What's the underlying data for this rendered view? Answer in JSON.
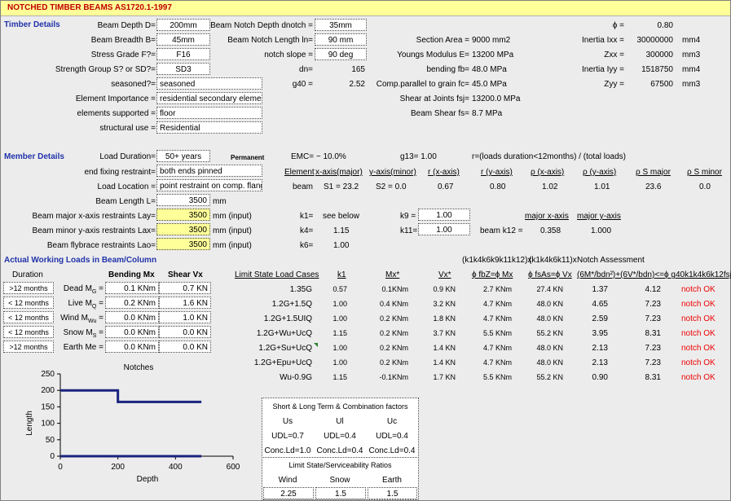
{
  "title": "NOTCHED TIMBER BEAMS  AS1720.1-1997",
  "timber": {
    "section_label": "Timber Details",
    "depth_label": "Beam Depth D=",
    "depth_value": "200mm",
    "breadth_label": "Beam Breadth B=",
    "breadth_value": "45mm",
    "grade_label": "Stress Grade F?=",
    "grade_value": "F16",
    "group_label": "Strength Group S? or SD?=",
    "group_value": "SD3",
    "seasoned_label": "seasoned?=",
    "seasoned_value": "seasoned",
    "importance_label": "Element Importance =",
    "importance_value": "residential secondary element",
    "supported_label": "elements supported =",
    "supported_value": "floor",
    "use_label": "structural use =",
    "use_value": "Residential",
    "notch_depth_label": "Beam Notch Depth dnotch =",
    "notch_depth_value": "35mm",
    "notch_length_label": "Beam Notch Length ln=",
    "notch_length_value": "90 mm",
    "notch_slope_label": "notch slope =",
    "notch_slope_value": "90 deg",
    "dn_label": "dn=",
    "dn_value": "165",
    "g40_label": "g40 =",
    "g40_value": "2.52",
    "area_label": "Section Area =",
    "area_value": "9000 mm2",
    "modulus_label": "Youngs Modulus E=",
    "modulus_value": "13200 MPa",
    "bending_label": "bending fb=",
    "bending_value": "48.0 MPa",
    "compression_label": "Comp.parallel to grain fc=",
    "compression_value": "45.0 MPa",
    "shear_joints_label": "Shear at Joints fsj=",
    "shear_joints_value": "13200.0 MPa",
    "beam_shear_label": "Beam Shear fs=",
    "beam_shear_value": "8.7 MPa",
    "phi_label": "ϕ =",
    "phi_value": "0.80",
    "ixx_label": "Inertia Ixx =",
    "ixx_value": "30000000",
    "ixx_unit": "mm4",
    "zxx_label": "Zxx =",
    "zxx_value": "300000",
    "zxx_unit": "mm3",
    "iyy_label": "Inertia Iyy =",
    "iyy_value": "1518750",
    "iyy_unit": "mm4",
    "zyy_label": "Zyy =",
    "zyy_value": "67500",
    "zyy_unit": "mm3"
  },
  "member": {
    "section_label": "Member Details",
    "duration_label": "Load Duration=",
    "duration_value": "50+ years",
    "permanent": "Permanent",
    "fixing_label": "end fixing restraint=",
    "fixing_value": "both ends pinned",
    "location_label": "Load Location =",
    "location_value": "point restraint on comp. flange",
    "length_label": "Beam Length L=",
    "length_value": "3500",
    "length_unit": "mm",
    "lay_label": "Beam major x-axis restraints Lay=",
    "lay_value": "3500",
    "lay_unit": "mm (input)",
    "lax_label": "Beam minor y-axis restraints Lax=",
    "lax_value": "3500",
    "lax_unit": "mm (input)",
    "lao_label": "Beam flybrace restraints Lao=",
    "lao_value": "3500",
    "lao_unit": "mm (input)",
    "emc": "EMC= ~ 10.0%",
    "g13": "g13= 1.00",
    "r_text": "r=(loads duration<12months) / (total loads)",
    "headers": [
      "Element",
      "x-axis(major)",
      "y-axis(minor)",
      "r (x-axis)",
      "r (y-axis)",
      "ρ (x-axis)",
      "ρ (y-axis)",
      "ρ S major",
      "ρ S minor"
    ],
    "values": [
      "beam",
      "S1 = 23.2",
      "S2 = 0.0",
      "0.67",
      "0.80",
      "1.02",
      "1.01",
      "23.6",
      "0.0"
    ],
    "k1_label": "k1=",
    "k1_value": "see below",
    "k4_label": "k4=",
    "k4_value": "1.15",
    "k6_label": "k6=",
    "k6_value": "1.00",
    "k9_label": "k9 =",
    "k9_value": "1.00",
    "k11_label": "k11=",
    "k11_value": "1.00",
    "k12_label": "beam k12 =",
    "k12_major_header": "major x-axis",
    "k12_minor_header": "major y-axis",
    "k12_major_value": "0.358",
    "k12_minor_value": "1.000"
  },
  "loads": {
    "section_label": "Actual Working Loads in Beam/Column",
    "duration_header": "Duration",
    "bending_header": "Bending Mx",
    "shear_header": "Shear Vx",
    "rows": [
      {
        "duration": ">12 months",
        "label": "Dead M",
        "sub": "G",
        "mx": "0.1 KNm",
        "vx": "0.7 KN"
      },
      {
        "duration": "< 12 months",
        "label": "Live M",
        "sub": "Q",
        "mx": "0.2 KNm",
        "vx": "1.6 KN"
      },
      {
        "duration": "< 12 months",
        "label": "Wind M",
        "sub": "Wu",
        "mx": "0.0 KNm",
        "vx": "1.0 KN"
      },
      {
        "duration": "< 12 months",
        "label": "Snow M",
        "sub": "S",
        "mx": "0.0 KNm",
        "vx": "0.0 KN"
      },
      {
        "duration": ">12 months",
        "label": "Earth Me",
        "sub": "",
        "mx": "0.0 KNm",
        "vx": "0.0 KN"
      }
    ]
  },
  "limit_states": {
    "header_cases": "Limit State Load Cases",
    "header_k1": "k1",
    "header_mx": "Mx*",
    "header_vx": "Vx*",
    "header_group1": "(k1k4k6k9k11k12)x",
    "header_group2": "(k1k4k6k11)x",
    "header_notch": "Notch Assessment",
    "header_phifbz": "ϕ fbZ=ϕ Mx",
    "header_phifsas": "ϕ fsAs=ϕ Vx",
    "header_formula": "(6M*/bdn²)+(6V*/bdn)<=ϕ g40k1k4k6k12fsj",
    "rows": [
      {
        "case": "1.35G",
        "k1": "0.57",
        "mx": "0.1KNm",
        "vx": "0.9 KN",
        "phimx": "2.7 KNm",
        "phivx": "27.4 KN",
        "lhs": "1.37",
        "rhs": "4.12",
        "status": "notch OK"
      },
      {
        "case": "1.2G+1.5Q",
        "k1": "1.00",
        "mx": "0.4 KNm",
        "vx": "3.2 KN",
        "phimx": "4.7 KNm",
        "phivx": "48.0 KN",
        "lhs": "4.65",
        "rhs": "7.23",
        "status": "notch OK"
      },
      {
        "case": "1.2G+1.5UIQ",
        "k1": "1.00",
        "mx": "0.2 KNm",
        "vx": "1.8 KN",
        "phimx": "4.7 KNm",
        "phivx": "48.0 KN",
        "lhs": "2.59",
        "rhs": "7.23",
        "status": "notch OK"
      },
      {
        "case": "1.2G+Wu+UcQ",
        "k1": "1.15",
        "mx": "0.2 KNm",
        "vx": "3.7 KN",
        "phimx": "5.5 KNm",
        "phivx": "55.2 KN",
        "lhs": "3.95",
        "rhs": "8.31",
        "status": "notch OK"
      },
      {
        "case": "1.2G+Su+UcQ",
        "k1": "1.00",
        "mx": "0.2 KNm",
        "vx": "1.4 KN",
        "phimx": "4.7 KNm",
        "phivx": "48.0 KN",
        "lhs": "2.13",
        "rhs": "7.23",
        "status": "notch OK"
      },
      {
        "case": "1.2G+Epu+UcQ",
        "k1": "1.00",
        "mx": "0.2 KNm",
        "vx": "1.4 KN",
        "phimx": "4.7 KNm",
        "phivx": "48.0 KN",
        "lhs": "2.13",
        "rhs": "7.23",
        "status": "notch OK"
      },
      {
        "case": "Wu-0.9G",
        "k1": "1.15",
        "mx": "-0.1KNm",
        "vx": "1.7 KN",
        "phimx": "5.5 KNm",
        "phivx": "55.2 KN",
        "lhs": "0.90",
        "rhs": "8.31",
        "status": "notch OK"
      }
    ]
  },
  "factors": {
    "title": "Short & Long Term & Combination factors",
    "headers": [
      "Us",
      "Ul",
      "Uc"
    ],
    "udl": [
      "UDL=0.7",
      "UDL=0.4",
      "UDL=0.4"
    ],
    "conc": [
      "Conc.Ld=1.0",
      "Conc.Ld=0.4",
      "Conc.Ld=0.4"
    ],
    "ratios_title": "Limit State/Serviceability Ratios",
    "ratio_headers": [
      "Wind",
      "Snow",
      "Earth"
    ],
    "ratio_values": [
      "2.25",
      "1.5",
      "1.5"
    ]
  },
  "colors": {
    "title_bg": "#ffff99",
    "title_text": "#c00000",
    "section_text": "#2233aa",
    "status_ok": "#ee0000",
    "input_yellow": "#ffff99",
    "chart_line": "#1a237e"
  },
  "chart_data": {
    "type": "line",
    "title": "Notches",
    "xlabel": "Depth",
    "ylabel": "Length",
    "xlim": [
      0,
      600
    ],
    "ylim": [
      0,
      250
    ],
    "x_ticks": [
      "0",
      "200",
      "400",
      "600"
    ],
    "y_ticks": [
      "0",
      "50",
      "100",
      "150",
      "200",
      "250"
    ],
    "grid": false,
    "legend": "none",
    "series": [
      {
        "points": [
          [
            0,
            200
          ],
          [
            200,
            200
          ],
          [
            200,
            165
          ],
          [
            490,
            165
          ]
        ]
      },
      {
        "points": [
          [
            0,
            0
          ],
          [
            490,
            0
          ]
        ]
      }
    ]
  }
}
